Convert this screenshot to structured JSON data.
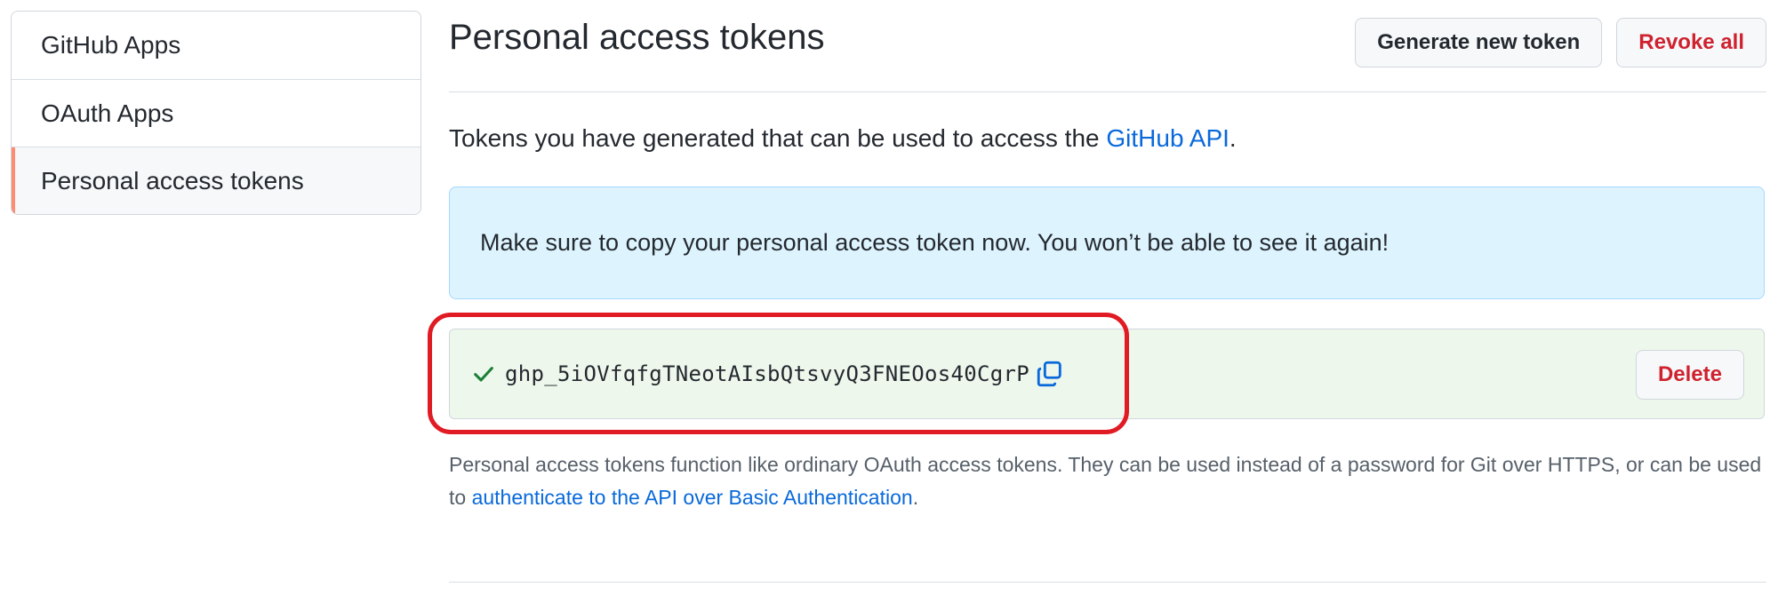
{
  "sidebar": {
    "items": [
      {
        "label": "GitHub Apps"
      },
      {
        "label": "OAuth Apps"
      },
      {
        "label": "Personal access tokens",
        "selected": true
      }
    ]
  },
  "header": {
    "title": "Personal access tokens",
    "generate_label": "Generate new token",
    "revoke_label": "Revoke all"
  },
  "intro": {
    "text_before": "Tokens you have generated that can be used to access the ",
    "link_text": "GitHub API",
    "text_after": "."
  },
  "flash": {
    "message": "Make sure to copy your personal access token now. You won’t be able to see it again!"
  },
  "token": {
    "value": "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",
    "delete_label": "Delete",
    "status_icon": "check-icon",
    "copy_icon": "copy-icon"
  },
  "note": {
    "text": "Personal access tokens function like ordinary OAuth access tokens. They can be used instead of a password for Git over HTTPS, or can be used to ",
    "link_text": "authenticate to the API over Basic Authentication",
    "text_after": "."
  },
  "colors": {
    "accent_link": "#0969da",
    "danger": "#cf222e",
    "success": "#1a7f37",
    "highlight_ring": "#e01b24",
    "selected_indicator": "#fd8c73"
  }
}
